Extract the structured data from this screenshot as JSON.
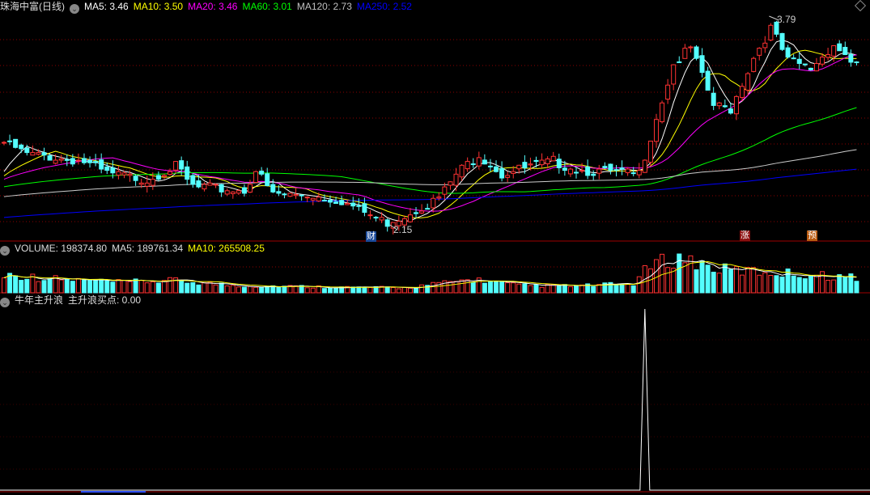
{
  "header": {
    "title": "珠海中富(日线)",
    "ma": [
      {
        "label": "MA5: 3.46",
        "color": "#ffffff"
      },
      {
        "label": "MA10: 3.50",
        "color": "#ffff00"
      },
      {
        "label": "MA20: 3.46",
        "color": "#ff00ff"
      },
      {
        "label": "MA60: 3.01",
        "color": "#00ff00"
      },
      {
        "label": "MA120: 2.73",
        "color": "#c0c0c0"
      },
      {
        "label": "MA250: 2.52",
        "color": "#0000ff"
      }
    ]
  },
  "volume_header": {
    "volume": "VOLUME: 198374.80",
    "ma5": "MA5: 189761.34",
    "ma10": "MA10: 265508.25"
  },
  "indicator_header": {
    "name": "牛年主升浪",
    "value": "主升浪买点: 0.00"
  },
  "annotations": {
    "high": "3.79",
    "low": "2.15",
    "marker_cai": "财",
    "marker_zhang": "涨",
    "marker_yu": "预"
  },
  "colors": {
    "up": "#ff3232",
    "down": "#54ffff",
    "grid": "#8b0000"
  },
  "chart_data": {
    "type": "candlestick",
    "count": 150,
    "price_range": [
      2.05,
      3.95
    ],
    "close_anchors": [
      [
        0,
        2.83
      ],
      [
        4,
        2.74
      ],
      [
        14,
        2.68
      ],
      [
        18,
        2.58
      ],
      [
        25,
        2.54
      ],
      [
        30,
        2.64
      ],
      [
        33,
        2.48
      ],
      [
        42,
        2.45
      ],
      [
        44,
        2.61
      ],
      [
        47,
        2.42
      ],
      [
        53,
        2.42
      ],
      [
        59,
        2.37
      ],
      [
        63,
        2.28
      ],
      [
        67,
        2.2
      ],
      [
        70,
        2.26
      ],
      [
        76,
        2.39
      ],
      [
        79,
        2.58
      ],
      [
        83,
        2.74
      ],
      [
        87,
        2.58
      ],
      [
        96,
        2.68
      ],
      [
        101,
        2.61
      ],
      [
        111,
        2.58
      ],
      [
        114,
        3.03
      ],
      [
        117,
        3.44
      ],
      [
        120,
        3.57
      ],
      [
        124,
        3.12
      ],
      [
        127,
        3.09
      ],
      [
        131,
        3.5
      ],
      [
        134,
        3.73
      ],
      [
        137,
        3.47
      ],
      [
        141,
        3.41
      ],
      [
        145,
        3.6
      ],
      [
        149,
        3.44
      ]
    ],
    "volume_anchors": [
      [
        0,
        300000
      ],
      [
        10,
        220000
      ],
      [
        20,
        170000
      ],
      [
        30,
        200000
      ],
      [
        40,
        120000
      ],
      [
        60,
        90000
      ],
      [
        70,
        80000
      ],
      [
        76,
        150000
      ],
      [
        82,
        220000
      ],
      [
        90,
        120000
      ],
      [
        100,
        110000
      ],
      [
        110,
        150000
      ],
      [
        113,
        450000
      ],
      [
        118,
        580000
      ],
      [
        125,
        380000
      ],
      [
        135,
        330000
      ],
      [
        149,
        250000
      ]
    ],
    "volume_max": 700000,
    "indicator": {
      "spike_index": 112,
      "values_max": 1
    },
    "high_index": 134,
    "low_index": 67
  }
}
